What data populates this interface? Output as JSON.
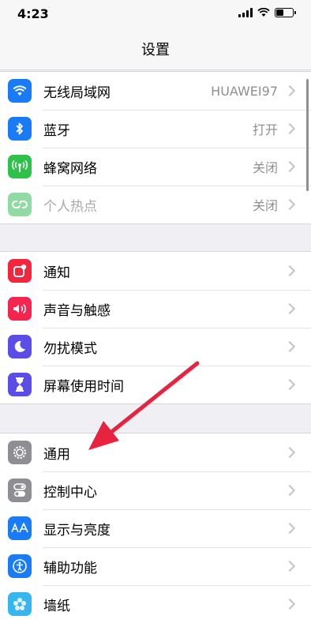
{
  "status": {
    "time": "4:23"
  },
  "nav": {
    "title": "设置"
  },
  "colors": {
    "red_arrow": "#e8233f"
  },
  "groups": [
    {
      "items": [
        {
          "label": "无线局域网",
          "value": "HUAWEI97",
          "icon": "wifi-icon",
          "color": "#1a7cf5"
        },
        {
          "label": "蓝牙",
          "value": "打开",
          "icon": "bluetooth-icon",
          "color": "#1a7cf5"
        },
        {
          "label": "蜂窝网络",
          "value": "关闭",
          "icon": "cellular-icon",
          "color": "#2fc24a"
        },
        {
          "label": "个人热点",
          "value": "关闭",
          "icon": "hotspot-icon",
          "color": "#8fdba3"
        }
      ]
    },
    {
      "items": [
        {
          "label": "通知",
          "value": "",
          "icon": "notification-icon",
          "color": "#f4263d"
        },
        {
          "label": "声音与触感",
          "value": "",
          "icon": "sound-icon",
          "color": "#f4264f"
        },
        {
          "label": "勿扰模式",
          "value": "",
          "icon": "moon-icon",
          "color": "#5a4ee6"
        },
        {
          "label": "屏幕使用时间",
          "value": "",
          "icon": "hourglass-icon",
          "color": "#5a4ee6"
        }
      ]
    },
    {
      "items": [
        {
          "label": "通用",
          "value": "",
          "icon": "gear-icon",
          "color": "#8e8e93"
        },
        {
          "label": "控制中心",
          "value": "",
          "icon": "toggles-icon",
          "color": "#8e8e93"
        },
        {
          "label": "显示与亮度",
          "value": "",
          "icon": "display-icon",
          "color": "#1a7cf5"
        },
        {
          "label": "辅助功能",
          "value": "",
          "icon": "accessibility-icon",
          "color": "#1a7cf5"
        },
        {
          "label": "墙纸",
          "value": "",
          "icon": "wallpaper-icon",
          "color": "#35b6ef"
        }
      ]
    }
  ]
}
